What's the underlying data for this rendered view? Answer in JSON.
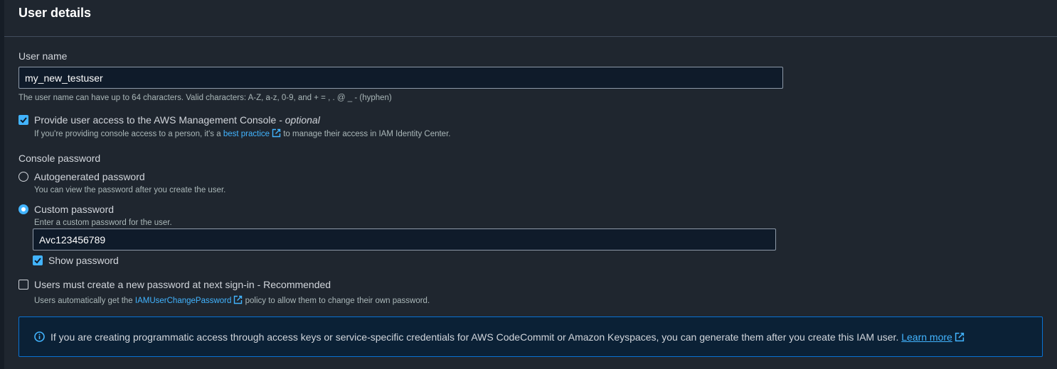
{
  "section": {
    "title": "User details"
  },
  "user_name": {
    "label": "User name",
    "value": "my_new_testuser",
    "hint": "The user name can have up to 64 characters. Valid characters: A-Z, a-z, 0-9, and + = , . @ _ - (hyphen)"
  },
  "console_access": {
    "checked": true,
    "label": "Provide user access to the AWS Management Console - ",
    "optional": "optional",
    "hint_before": "If you're providing console access to a person, it's a ",
    "hint_link": "best practice",
    "hint_after": " to manage their access in IAM Identity Center."
  },
  "console_password": {
    "label": "Console password",
    "auto": {
      "selected": false,
      "label": "Autogenerated password",
      "hint": "You can view the password after you create the user."
    },
    "custom": {
      "selected": true,
      "label": "Custom password",
      "hint": "Enter a custom password for the user.",
      "value": "Avc123456789"
    },
    "show_password": {
      "checked": true,
      "label": "Show password"
    }
  },
  "reset_required": {
    "checked": false,
    "label": "Users must create a new password at next sign-in - Recommended",
    "hint_before": "Users automatically get the ",
    "hint_link": "IAMUserChangePassword",
    "hint_after": " policy to allow them to change their own password."
  },
  "info": {
    "text": "If you are creating programmatic access through access keys or service-specific credentials for AWS CodeCommit or Amazon Keyspaces, you can generate them after you create this IAM user. ",
    "link": "Learn more"
  },
  "colors": {
    "accent": "#42b4ff",
    "info_border": "#0972d3",
    "background": "#1f262f"
  },
  "icons": [
    "checkbox-checked-icon",
    "external-link-icon",
    "info-icon"
  ]
}
